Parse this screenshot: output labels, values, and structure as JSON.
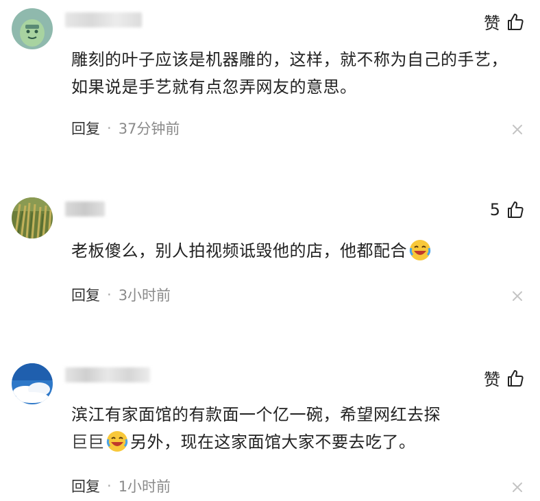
{
  "comments": [
    {
      "likes": "赞",
      "text": "雕刻的叶子应该是机器雕的，这样，就不称为自己的手艺，如果说是手艺就有点忽弄网友的意思。",
      "reply_label": "回复",
      "separator": "·",
      "time": "37分钟前"
    },
    {
      "likes": "5",
      "text": "老板傻么，别人拍视频诋毁他的店，他都配合",
      "reply_label": "回复",
      "separator": "·",
      "time": "3小时前"
    },
    {
      "likes": "赞",
      "text_part1": "滨江有家面馆的有款面一个亿一碗，希望网红去探",
      "text_part2_prefix": "巨巨",
      "text_part2": "另外，现在这家面馆大家不要去吃了。",
      "reply_label": "回复",
      "separator": "·",
      "time": "1小时前"
    }
  ],
  "icons": {
    "like": "thumbs-up-outline",
    "close": "close-x",
    "emoji": "laughing-crying-emoji"
  },
  "colors": {
    "text": "#222222",
    "meta": "#8a8a8a",
    "close": "#c4c4c4"
  }
}
